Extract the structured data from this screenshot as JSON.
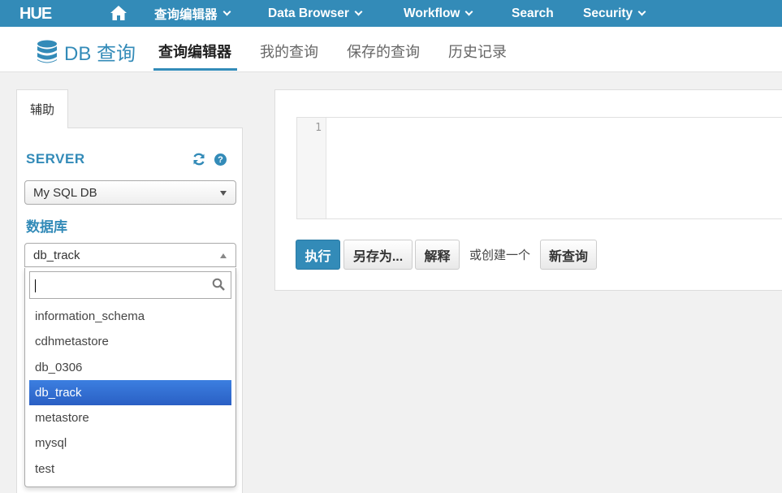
{
  "topnav": {
    "logo": "HUE",
    "items": [
      {
        "label": "查询编辑器"
      },
      {
        "label": "Data Browser"
      },
      {
        "label": "Workflow"
      },
      {
        "label": "Search"
      },
      {
        "label": "Security"
      }
    ]
  },
  "subnav": {
    "app_title": "DB 查询",
    "tabs": [
      {
        "label": "查询编辑器",
        "active": true
      },
      {
        "label": "我的查询"
      },
      {
        "label": "保存的查询"
      },
      {
        "label": "历史记录"
      }
    ]
  },
  "assist": {
    "tab_label": "辅助",
    "server_label": "SERVER",
    "server_select": "My SQL DB",
    "db_label": "数据库",
    "db_select": "db_track",
    "search_value": "",
    "db_options": [
      {
        "label": "information_schema"
      },
      {
        "label": "cdhmetastore"
      },
      {
        "label": "db_0306"
      },
      {
        "label": "db_track",
        "selected": true
      },
      {
        "label": "metastore"
      },
      {
        "label": "mysql"
      },
      {
        "label": "test"
      }
    ]
  },
  "editor": {
    "line_number": "1",
    "content": ""
  },
  "actions": {
    "execute": "执行",
    "save_as": "另存为...",
    "explain": "解释",
    "or_create": "或创建一个",
    "new_query": "新查询"
  },
  "colors": {
    "brand": "#338bb8",
    "selected": "#3875d7"
  }
}
